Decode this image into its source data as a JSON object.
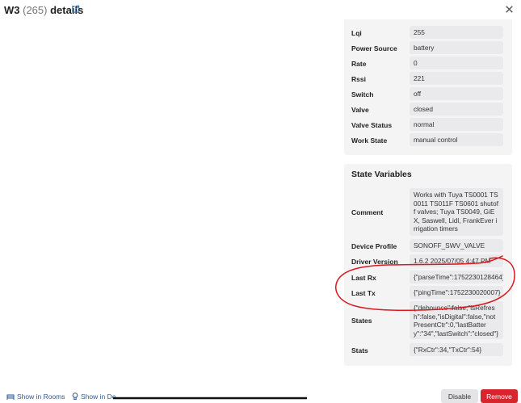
{
  "dialog": {
    "title_name": "W3",
    "title_count": "(265)",
    "title_suffix": "details"
  },
  "attributes": [
    {
      "label": "Lqi",
      "value": "255"
    },
    {
      "label": "Power Source",
      "value": "battery"
    },
    {
      "label": "Rate",
      "value": "0"
    },
    {
      "label": "Rssi",
      "value": "221"
    },
    {
      "label": "Switch",
      "value": "off"
    },
    {
      "label": "Valve",
      "value": "closed"
    },
    {
      "label": "Valve Status",
      "value": "normal"
    },
    {
      "label": "Work State",
      "value": "manual control"
    }
  ],
  "state_variables": {
    "heading": "State Variables",
    "rows": [
      {
        "label": "Comment",
        "value": "Works with Tuya TS0001 TS0011 TS011F TS0601 shutoff valves; Tuya TS0049, GiEX, Saswell, Lidl, FrankEver irrigation timers"
      },
      {
        "label": "Device Profile",
        "value": "SONOFF_SWV_VALVE"
      },
      {
        "label": "Driver Version",
        "value": "1.6.2 2025/07/05 4:47 PM"
      },
      {
        "label": "Last Rx",
        "value": "{\"parseTime\":1752230128464}"
      },
      {
        "label": "Last Tx",
        "value": "{\"pingTime\":1752230020007}"
      },
      {
        "label": "States",
        "value": "{\"debounce\":false,\"isRefresh\":false,\"isDigital\":false,\"notPresentCtr\":0,\"lastBattery\":\"34\",\"lastSwitch\":\"closed\"}"
      },
      {
        "label": "Stats",
        "value": "{\"RxCtr\":34,\"TxCtr\":54}"
      }
    ]
  },
  "footer": {
    "show_in_rooms": "Show in Rooms",
    "show_in_dashboard": "Show in De",
    "disable_label": "Disable",
    "remove_label": "Remove"
  },
  "colors": {
    "remove_button": "#d7262b",
    "annotation_ink": "#d9191f",
    "link": "#2e5a8f"
  },
  "icons": [
    "external-link-icon",
    "close-icon",
    "rooms-icon",
    "lightbulb-icon"
  ]
}
